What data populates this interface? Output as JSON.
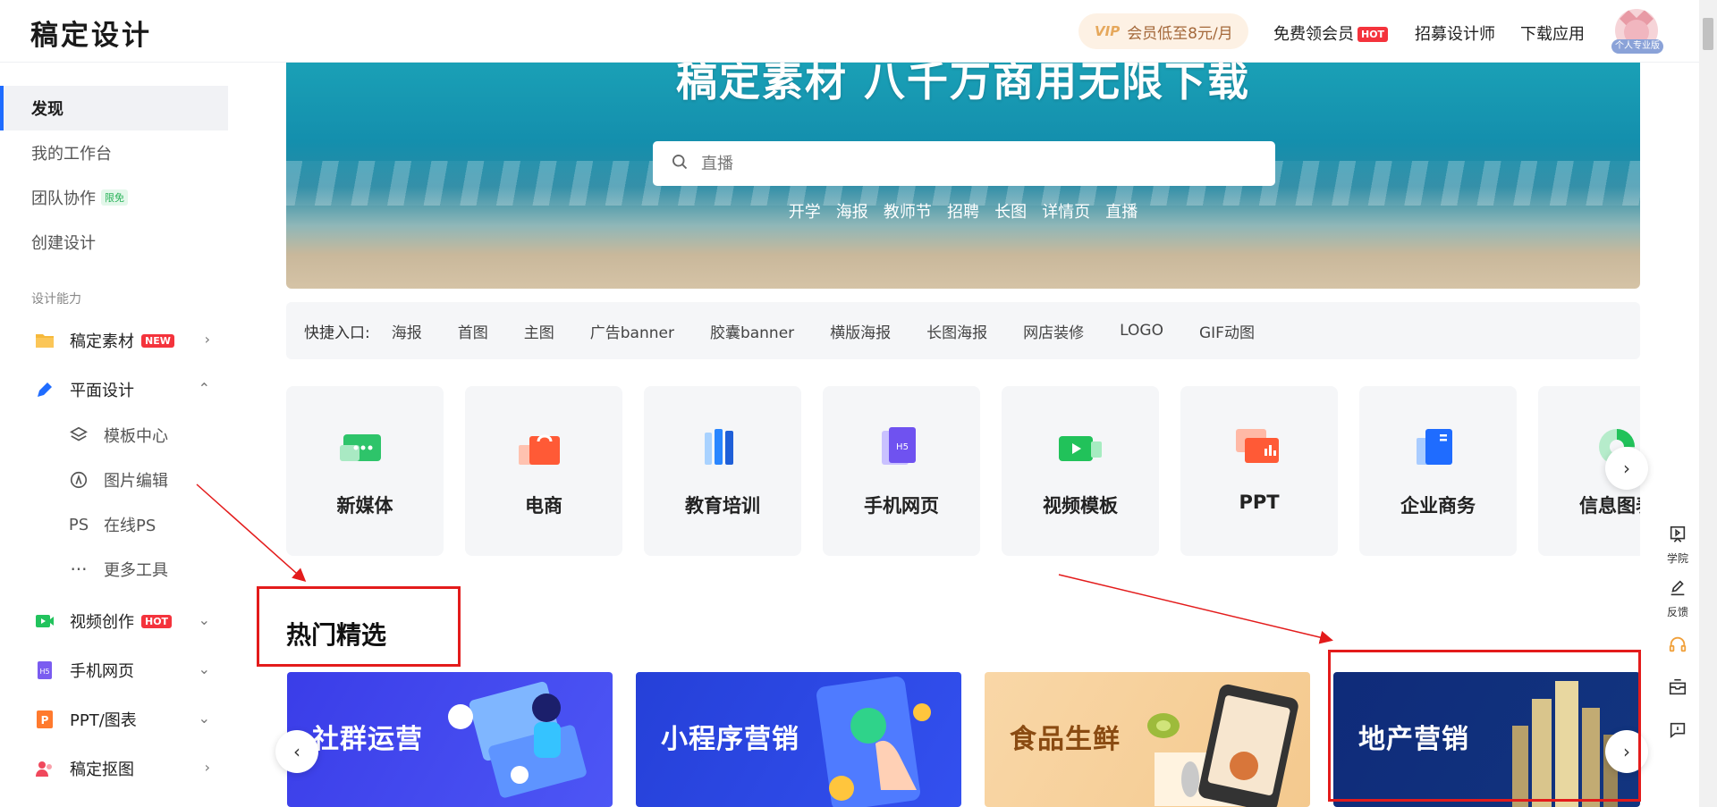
{
  "header": {
    "logo": "稿定设计",
    "vip_badge": "VIP",
    "vip_text": "会员低至8元/月",
    "free_member": "免费领会员",
    "hot_tag": "HOT",
    "recruit": "招募设计师",
    "download": "下载应用",
    "avatar_tag": "个人专业版"
  },
  "sidebar": {
    "items": [
      {
        "label": "发现",
        "active": true
      },
      {
        "label": "我的工作台"
      },
      {
        "label": "团队协作",
        "tag": "限免"
      },
      {
        "label": "创建设计"
      }
    ],
    "section_title": "设计能力",
    "groups": [
      {
        "label": "稿定素材",
        "tag": "NEW",
        "chevron": "›",
        "icon": "folder-icon"
      },
      {
        "label": "平面设计",
        "chevron": "⌃",
        "icon": "pen-icon"
      },
      {
        "label": "视频创作",
        "tag": "HOT",
        "chevron": "⌄",
        "icon": "video-icon"
      },
      {
        "label": "手机网页",
        "chevron": "⌄",
        "icon": "h5-icon"
      },
      {
        "label": "PPT/图表",
        "chevron": "⌄",
        "icon": "ppt-icon"
      },
      {
        "label": "稿定抠图",
        "chevron": "›",
        "icon": "cutout-icon"
      }
    ],
    "sub_items": [
      {
        "label": "模板中心",
        "icon": "layers-icon"
      },
      {
        "label": "图片编辑",
        "icon": "compass-icon"
      },
      {
        "label": "在线PS",
        "icon_text": "PS"
      },
      {
        "label": "更多工具",
        "icon_text": "···"
      }
    ]
  },
  "banner": {
    "title": "稿定素材 八千万商用无限下载",
    "search_placeholder": "直播",
    "hot_words": [
      "开学",
      "海报",
      "教师节",
      "招聘",
      "长图",
      "详情页",
      "直播"
    ]
  },
  "quick_entry": {
    "label": "快捷入口:",
    "links": [
      "海报",
      "首图",
      "主图",
      "广告banner",
      "胶囊banner",
      "横版海报",
      "长图海报",
      "网店装修",
      "LOGO",
      "GIF动图"
    ]
  },
  "categories": [
    "新媒体",
    "电商",
    "教育培训",
    "手机网页",
    "视频模板",
    "PPT",
    "企业商务",
    "信息图表"
  ],
  "hot_section": {
    "title": "热门精选",
    "picks": [
      "社群运营",
      "小程序营销",
      "食品生鲜",
      "地产营销"
    ]
  },
  "side_tools": [
    "学院",
    "反馈"
  ],
  "colors": {
    "accent": "#1f6cff",
    "hot": "#f4333c",
    "annotation": "#e31b1b"
  }
}
